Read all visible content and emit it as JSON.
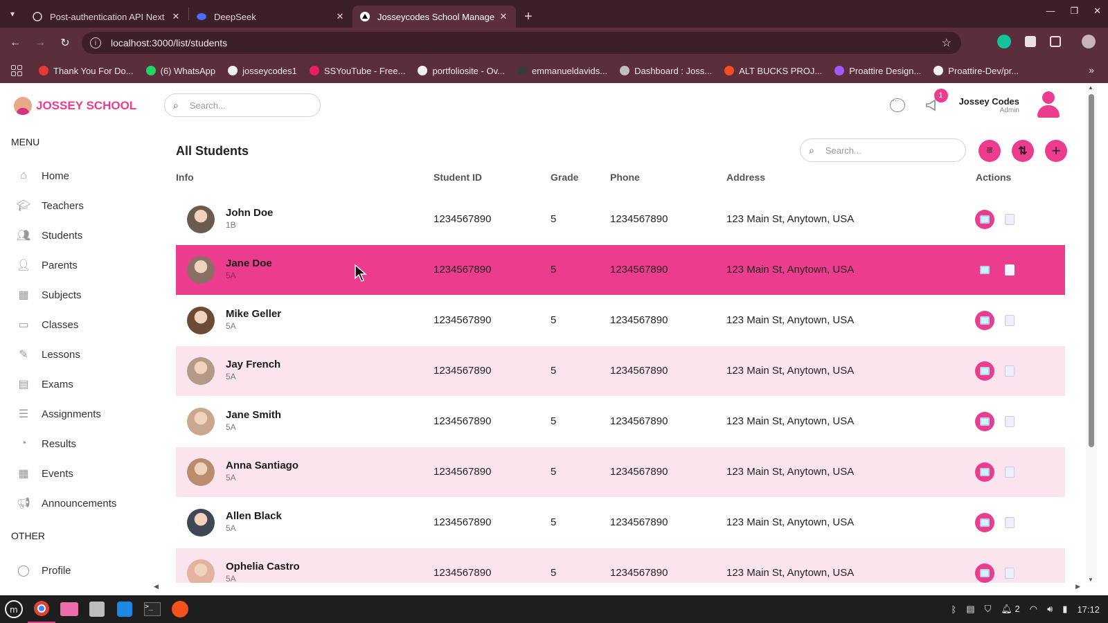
{
  "browser": {
    "tabs": [
      {
        "title": "Post-authentication API Next",
        "icon": "openai-icon",
        "active": false
      },
      {
        "title": "DeepSeek",
        "icon": "deepseek-icon",
        "active": false
      },
      {
        "title": "Josseycodes School Manage",
        "icon": "vercel-icon",
        "active": true
      }
    ],
    "url": "localhost:3000/list/students",
    "bookmarks": [
      {
        "label": "Thank You For Do...",
        "color": "#e53935"
      },
      {
        "label": "(6) WhatsApp",
        "color": "#25d366"
      },
      {
        "label": "josseycodes1",
        "color": "#f0f0f0"
      },
      {
        "label": "SSYouTube - Free...",
        "color": "#e91e63"
      },
      {
        "label": "portfoliosite - Ov...",
        "color": "#f0f0f0"
      },
      {
        "label": "emmanueldavids...",
        "color": "#3a3a3a"
      },
      {
        "label": "Dashboard : Joss...",
        "color": "#c0c0c0"
      },
      {
        "label": "ALT BUCKS PROJ...",
        "color": "#f24e1e"
      },
      {
        "label": "Proattire Design...",
        "color": "#a259ff"
      },
      {
        "label": "Proattire-Dev/pr...",
        "color": "#f0f0f0"
      }
    ]
  },
  "app": {
    "logo_text": "JOSSEY SCHOOL",
    "top_search_placeholder": "Search...",
    "announcement_count": "1",
    "user": {
      "name": "Jossey Codes",
      "role": "Admin"
    },
    "menu_title": "MENU",
    "menu_items": [
      {
        "label": "Home",
        "icon": "home-icon"
      },
      {
        "label": "Teachers",
        "icon": "teacher-icon"
      },
      {
        "label": "Students",
        "icon": "student-icon"
      },
      {
        "label": "Parents",
        "icon": "parent-icon"
      },
      {
        "label": "Subjects",
        "icon": "subject-icon"
      },
      {
        "label": "Classes",
        "icon": "class-icon"
      },
      {
        "label": "Lessons",
        "icon": "lesson-icon"
      },
      {
        "label": "Exams",
        "icon": "exam-icon"
      },
      {
        "label": "Assignments",
        "icon": "assignment-icon"
      },
      {
        "label": "Results",
        "icon": "result-icon"
      },
      {
        "label": "Events",
        "icon": "calendar-icon"
      },
      {
        "label": "Announcements",
        "icon": "announcement-icon"
      }
    ],
    "other_title": "OTHER",
    "other_items": [
      {
        "label": "Profile",
        "icon": "profile-icon"
      }
    ],
    "page_title": "All Students",
    "list_search_placeholder": "Search...",
    "columns": [
      "Info",
      "Student ID",
      "Grade",
      "Phone",
      "Address",
      "Actions"
    ],
    "students": [
      {
        "name": "John Doe",
        "class": "1B",
        "id": "1234567890",
        "grade": "5",
        "phone": "1234567890",
        "address": "123 Main St, Anytown, USA",
        "style": "plain",
        "avatar_color": "#6b5a4e"
      },
      {
        "name": "Jane Doe",
        "class": "5A",
        "id": "1234567890",
        "grade": "5",
        "phone": "1234567890",
        "address": "123 Main St, Anytown, USA",
        "style": "hover",
        "avatar_color": "#8a6f66"
      },
      {
        "name": "Mike Geller",
        "class": "5A",
        "id": "1234567890",
        "grade": "5",
        "phone": "1234567890",
        "address": "123 Main St, Anytown, USA",
        "style": "plain",
        "avatar_color": "#6a4b36"
      },
      {
        "name": "Jay French",
        "class": "5A",
        "id": "1234567890",
        "grade": "5",
        "phone": "1234567890",
        "address": "123 Main St, Anytown, USA",
        "style": "pink",
        "avatar_color": "#b49a86"
      },
      {
        "name": "Jane Smith",
        "class": "5A",
        "id": "1234567890",
        "grade": "5",
        "phone": "1234567890",
        "address": "123 Main St, Anytown, USA",
        "style": "plain",
        "avatar_color": "#c9a88f"
      },
      {
        "name": "Anna Santiago",
        "class": "5A",
        "id": "1234567890",
        "grade": "5",
        "phone": "1234567890",
        "address": "123 Main St, Anytown, USA",
        "style": "pink",
        "avatar_color": "#b98c6e"
      },
      {
        "name": "Allen Black",
        "class": "5A",
        "id": "1234567890",
        "grade": "5",
        "phone": "1234567890",
        "address": "123 Main St, Anytown, USA",
        "style": "plain",
        "avatar_color": "#3f4654"
      },
      {
        "name": "Ophelia Castro",
        "class": "5A",
        "id": "1234567890",
        "grade": "5",
        "phone": "1234567890",
        "address": "123 Main St, Anytown, USA",
        "style": "pink",
        "avatar_color": "#e2b39e"
      }
    ]
  },
  "taskbar": {
    "clock": "17:12",
    "notification_count": "2"
  },
  "colors": {
    "accent": "#ec3c8e",
    "row_pink": "#fce4ef",
    "chrome_dark": "#3c1f27",
    "chrome_mid": "#5a2f3b"
  }
}
